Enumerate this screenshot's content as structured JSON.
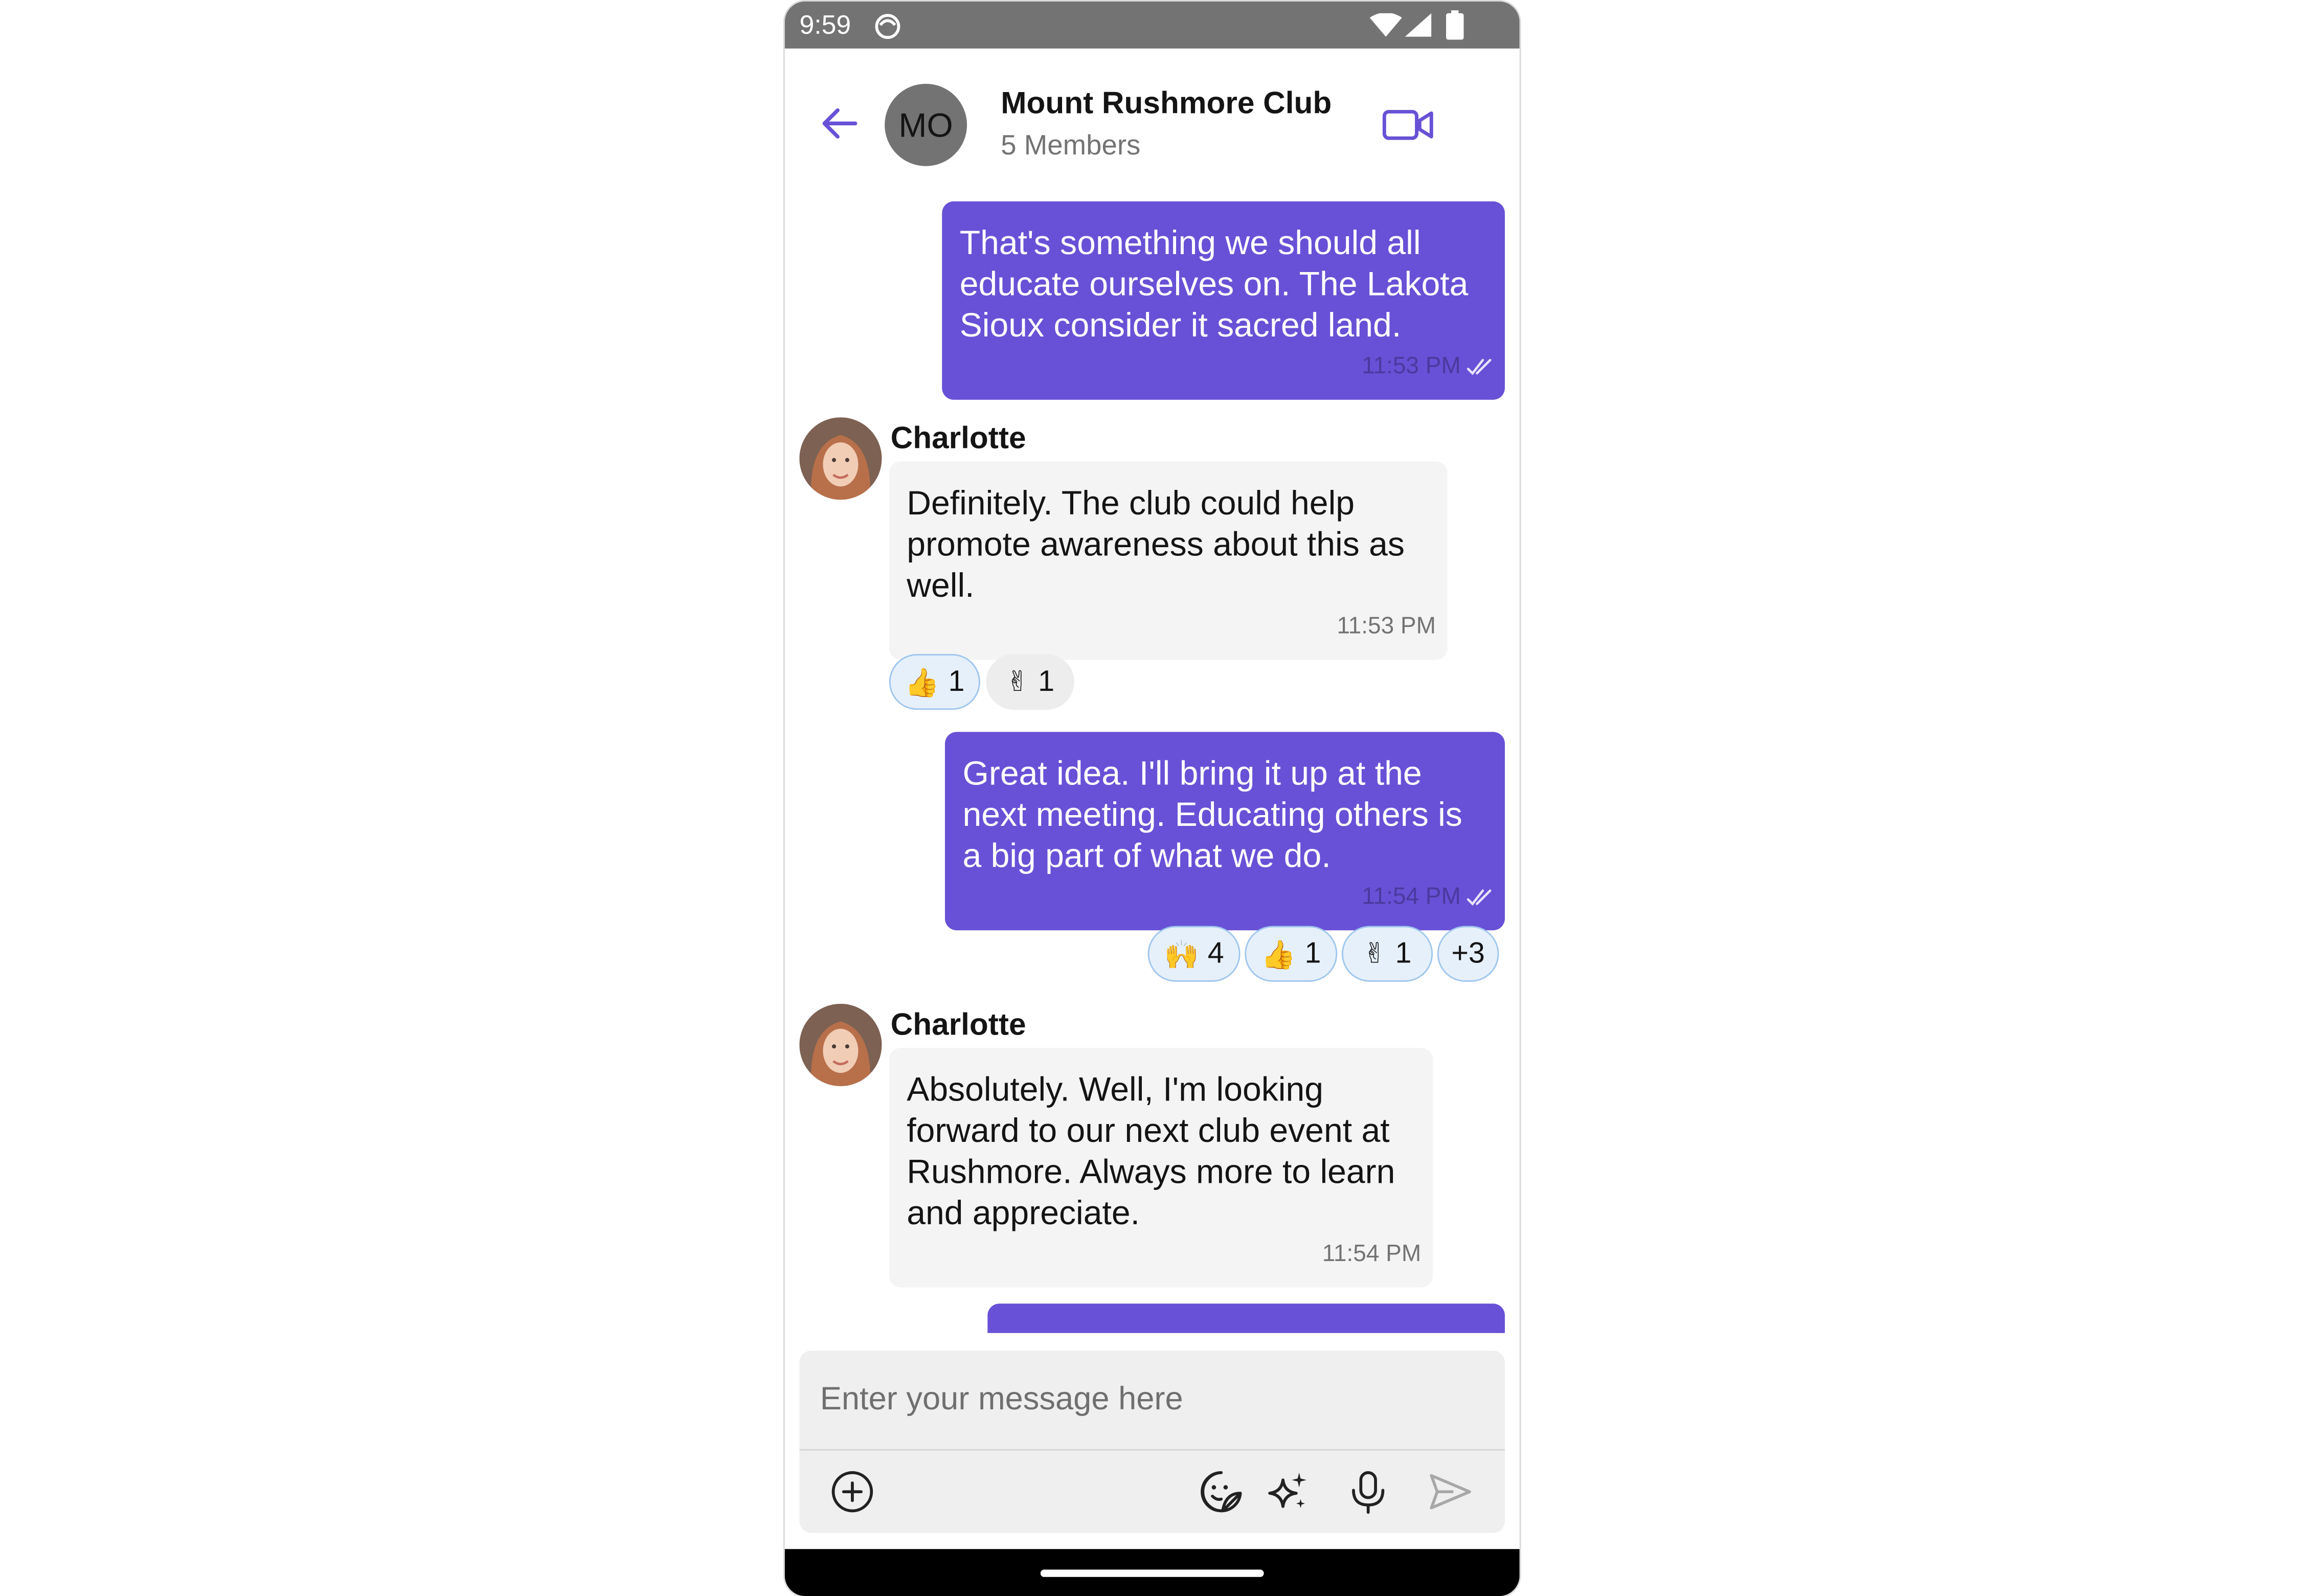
{
  "status_bar": {
    "time": "9:59"
  },
  "header": {
    "avatar_initials": "MO",
    "group_name": "Mount Rushmore Club",
    "members": "5 Members"
  },
  "messages": [
    {
      "id": "m1",
      "direction": "outgoing",
      "lines": [
        "That's something we should all",
        "educate ourselves on. The Lakota",
        "Sioux consider it sacred land."
      ],
      "time": "11:53 PM",
      "receipt": "read"
    },
    {
      "id": "m2",
      "direction": "incoming",
      "sender": "Charlotte",
      "lines": [
        "Definitely. The club could help",
        "promote awareness about this as",
        "well."
      ],
      "time": "11:53 PM",
      "reactions": [
        {
          "emoji": "👍",
          "count": "1",
          "mine": true
        },
        {
          "emoji": "✌",
          "count": "1",
          "mine": false
        }
      ]
    },
    {
      "id": "m3",
      "direction": "outgoing",
      "lines": [
        "Great idea. I'll bring it up at the",
        "next meeting. Educating others is",
        "a big part of what we do."
      ],
      "time": "11:54 PM",
      "receipt": "read",
      "reactions": [
        {
          "emoji": "🙌",
          "count": "4"
        },
        {
          "emoji": "👍",
          "count": "1"
        },
        {
          "emoji": "✌",
          "count": "1"
        },
        {
          "emoji": "",
          "count": "+3"
        }
      ]
    },
    {
      "id": "m4",
      "direction": "incoming",
      "sender": "Charlotte",
      "lines": [
        "Absolutely. Well, I'm looking",
        "forward to our next club event at",
        "Rushmore. Always more to learn",
        "and appreciate."
      ],
      "time": "11:54 PM"
    }
  ],
  "composer": {
    "placeholder": "Enter your message here"
  },
  "colors": {
    "accent": "#6851d6",
    "incoming_bubble": "#f4f4f4",
    "status_bar": "#737373"
  },
  "icons": [
    "back-arrow-icon",
    "video-call-icon",
    "add-attachment-icon",
    "sticker-icon",
    "ai-sparkle-icon",
    "microphone-icon",
    "send-icon",
    "read-receipt-icon"
  ]
}
